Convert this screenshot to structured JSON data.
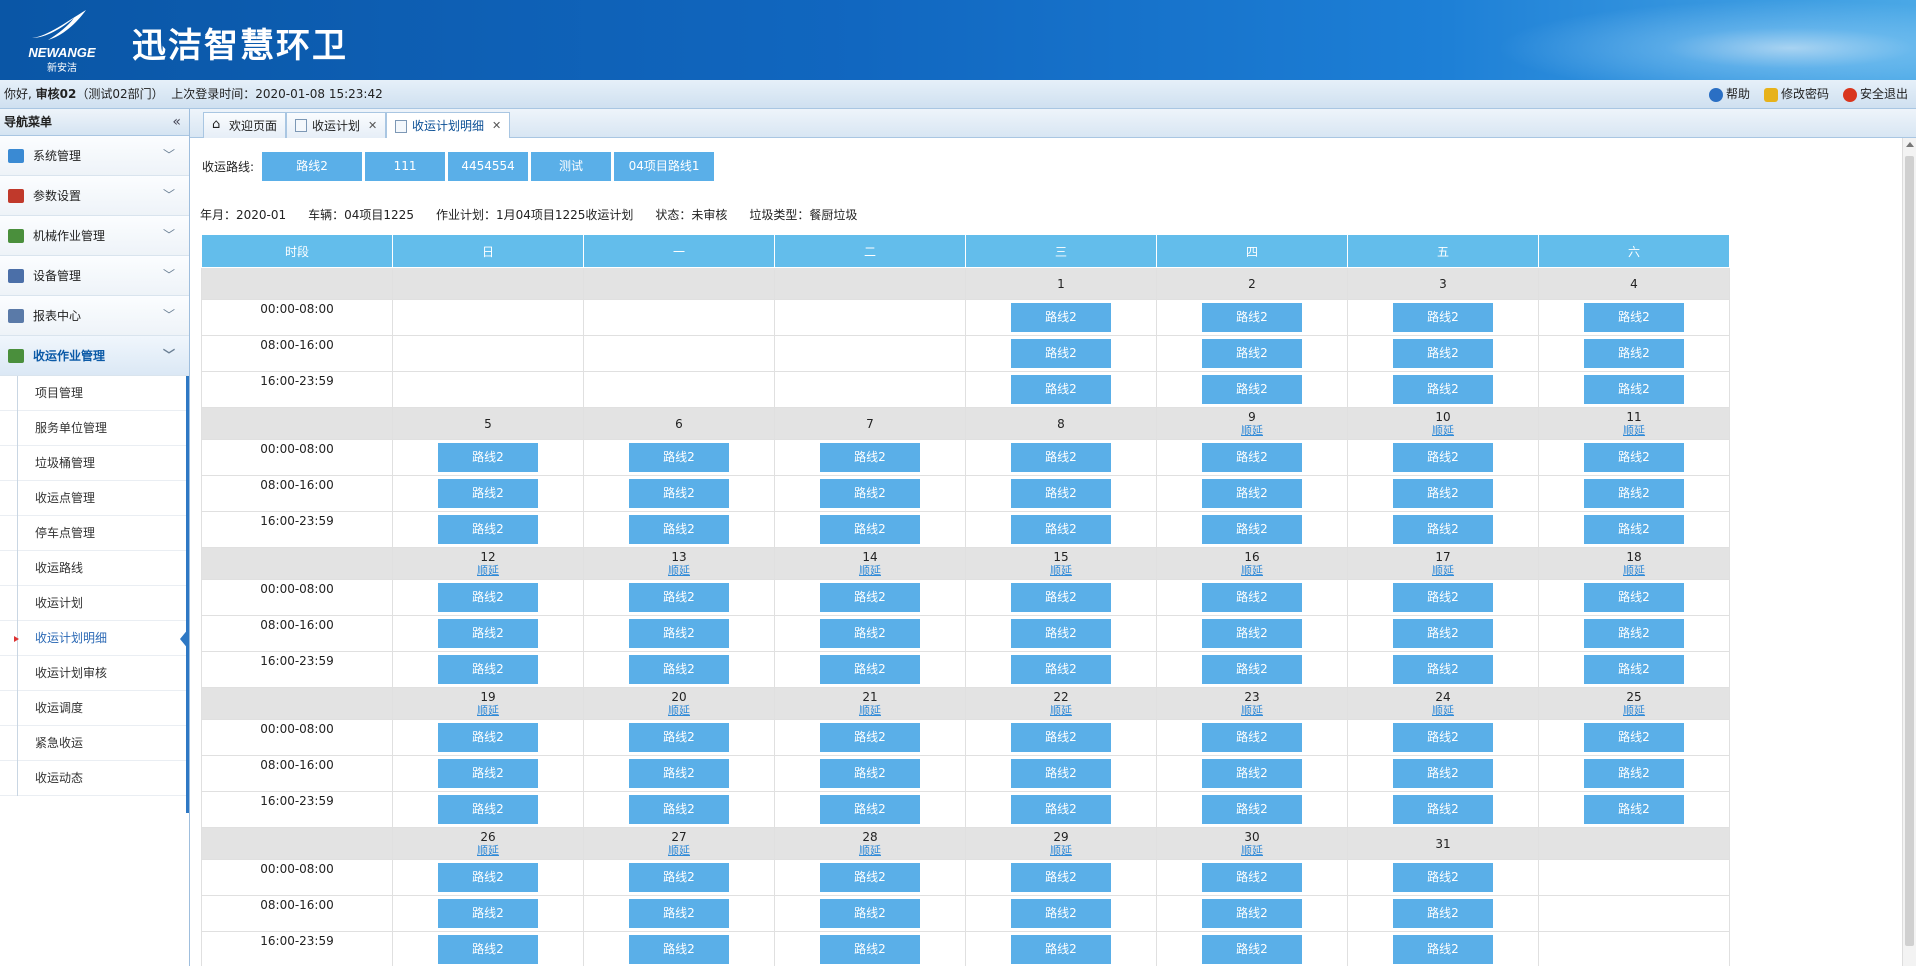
{
  "header": {
    "app_title": "迅洁智慧环卫",
    "logo_en": "NEWANGE",
    "logo_cn": "新安洁"
  },
  "userbar": {
    "greeting": "你好, ",
    "user": "审核02",
    "dept": "（测试02部门）",
    "last_login": "上次登录时间：2020-01-08 15:23:42",
    "help": "帮助",
    "change_pwd": "修改密码",
    "logout": "安全退出"
  },
  "sidebar": {
    "title": "导航菜单",
    "collapse": "«",
    "groups": [
      {
        "label": "系统管理",
        "icon_color": "#3a8ad3"
      },
      {
        "label": "参数设置",
        "icon_color": "#c0392b"
      },
      {
        "label": "机械作业管理",
        "icon_color": "#4a8f3c"
      },
      {
        "label": "设备管理",
        "icon_color": "#4b6fa8"
      },
      {
        "label": "报表中心",
        "icon_color": "#5a7aa8"
      },
      {
        "label": "收运作业管理",
        "icon_color": "#4a8f3c"
      }
    ],
    "sub_items": [
      "项目管理",
      "服务单位管理",
      "垃圾桶管理",
      "收运点管理",
      "停车点管理",
      "收运路线",
      "收运计划",
      "收运计划明细",
      "收运计划审核",
      "收运调度",
      "紧急收运",
      "收运动态"
    ]
  },
  "tabs": [
    {
      "label": "欢迎页面"
    },
    {
      "label": "收运计划"
    },
    {
      "label": "收运计划明细"
    }
  ],
  "routes": {
    "label": "收运路线:",
    "buttons": [
      "路线2",
      "111",
      "4454554",
      "测试",
      "04项目路线1"
    ]
  },
  "info": {
    "month": "年月：2020-01",
    "vehicle": "车辆：04项目1225",
    "plan": "作业计划：1月04项目1225收运计划",
    "status": "状态：未审核",
    "garbage_type": "垃圾类型：餐厨垃圾"
  },
  "calendar": {
    "headers": [
      "时段",
      "日",
      "一",
      "二",
      "三",
      "四",
      "五",
      "六"
    ],
    "slots": [
      "00:00-08:00",
      "08:00-16:00",
      "16:00-23:59"
    ],
    "route_label": "路线2",
    "postpone_label": "顺延",
    "weeks": [
      {
        "days": [
          null,
          null,
          null,
          "1",
          "2",
          "3",
          "4"
        ],
        "postpone": [
          false,
          false,
          false,
          false,
          false,
          false,
          false
        ]
      },
      {
        "days": [
          "5",
          "6",
          "7",
          "8",
          "9",
          "10",
          "11"
        ],
        "postpone": [
          false,
          false,
          false,
          false,
          true,
          true,
          true
        ]
      },
      {
        "days": [
          "12",
          "13",
          "14",
          "15",
          "16",
          "17",
          "18"
        ],
        "postpone": [
          true,
          true,
          true,
          true,
          true,
          true,
          true
        ]
      },
      {
        "days": [
          "19",
          "20",
          "21",
          "22",
          "23",
          "24",
          "25"
        ],
        "postpone": [
          true,
          true,
          true,
          true,
          true,
          true,
          true
        ]
      },
      {
        "days": [
          "26",
          "27",
          "28",
          "29",
          "30",
          "31",
          null
        ],
        "postpone": [
          true,
          true,
          true,
          true,
          true,
          false,
          false
        ]
      }
    ]
  },
  "colors": {
    "accent": "#5aafe8",
    "header_bg": "#63bdeb",
    "day_row_bg": "#e3e3e3",
    "nav_active": "#2e78c4"
  }
}
